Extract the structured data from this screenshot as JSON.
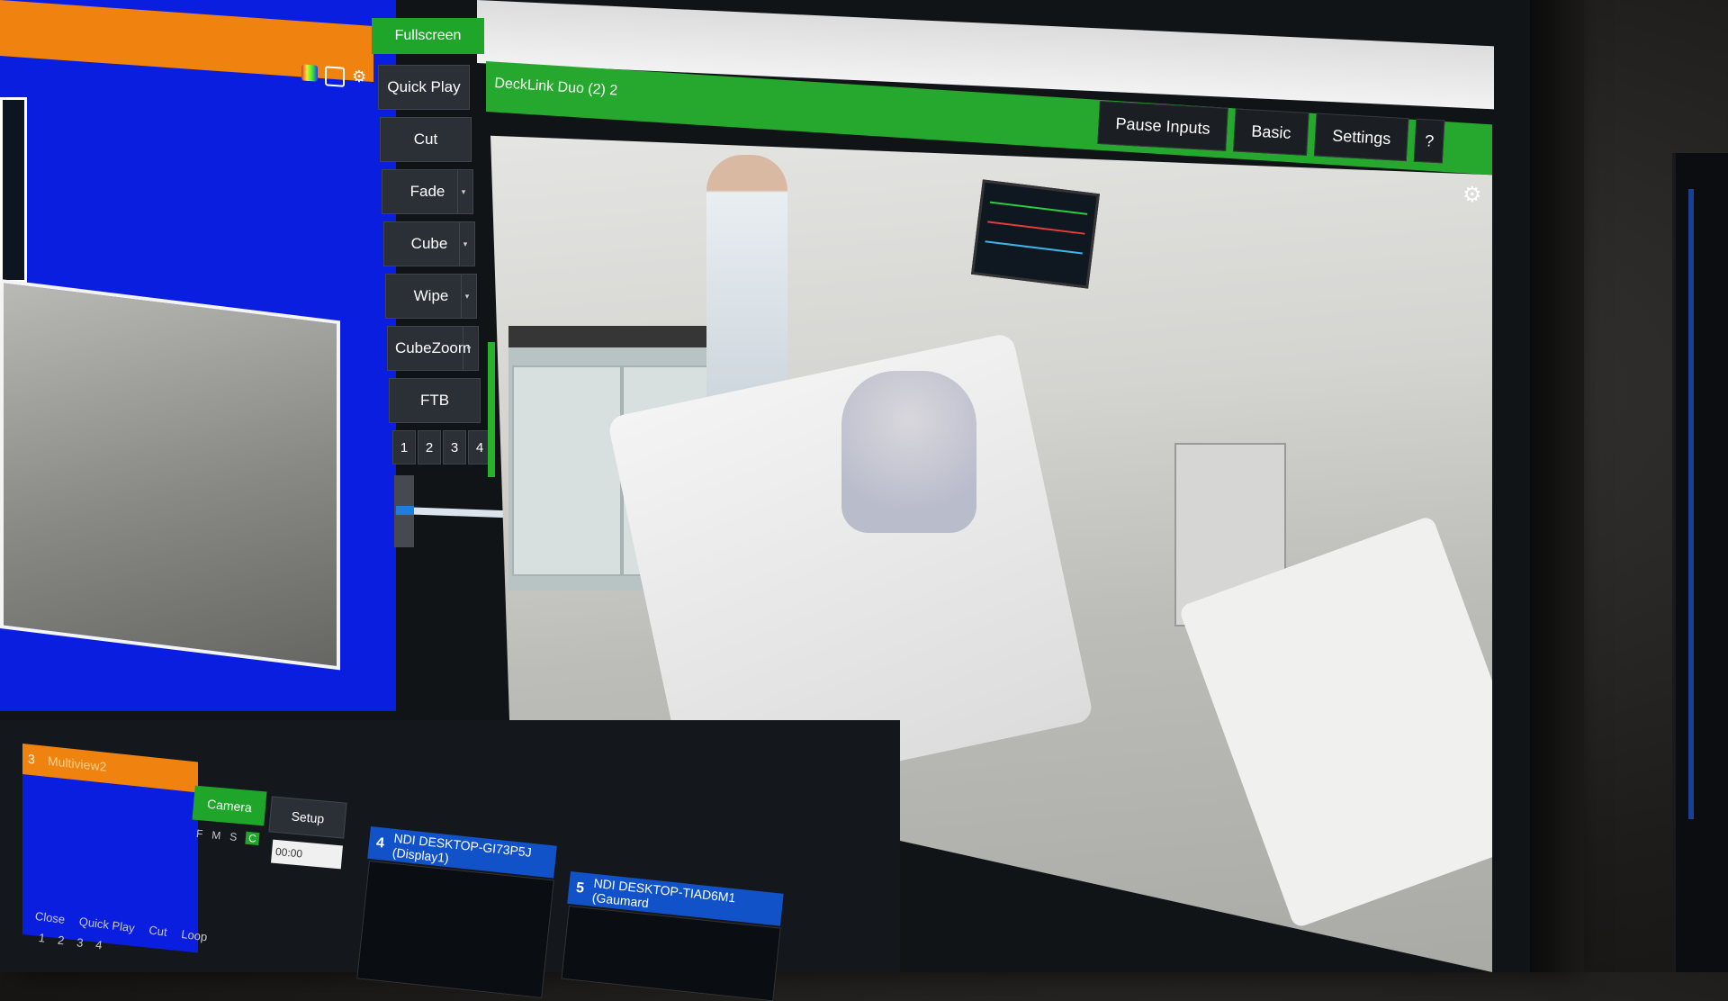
{
  "preview": {
    "header_icons": [
      "color-bars-icon",
      "window-icon",
      "gear-icon"
    ],
    "background_color": "#0a1ee0",
    "header_color": "#f0830f"
  },
  "transitions": {
    "fullscreen_label": "Fullscreen",
    "buttons": [
      "Quick Play",
      "Cut",
      "Fade",
      "Cube",
      "Wipe",
      "CubeZoom",
      "FTB"
    ],
    "numbers": [
      "1",
      "2",
      "3",
      "4"
    ]
  },
  "output": {
    "title": "DeckLink Duo (2) 2",
    "tabs": [
      "Pause Inputs",
      "Basic",
      "Settings",
      "?"
    ],
    "header_color": "#25a82d"
  },
  "inputs": {
    "input3": {
      "number": "3",
      "name": "Multiview2",
      "camera_label": "Camera",
      "setup_label": "Setup",
      "flags": [
        "F",
        "M",
        "S",
        "C"
      ],
      "time_value": "00:00",
      "footer": [
        "Close",
        "Quick Play",
        "Cut",
        "Loop"
      ],
      "footer_numbers": [
        "1",
        "2",
        "3",
        "4"
      ]
    },
    "input4": {
      "number": "4",
      "name": "NDI DESKTOP-GI73P5J (Display1)"
    },
    "input5": {
      "number": "5",
      "name": "NDI DESKTOP-TIAD6M1 (Gaumard"
    }
  }
}
